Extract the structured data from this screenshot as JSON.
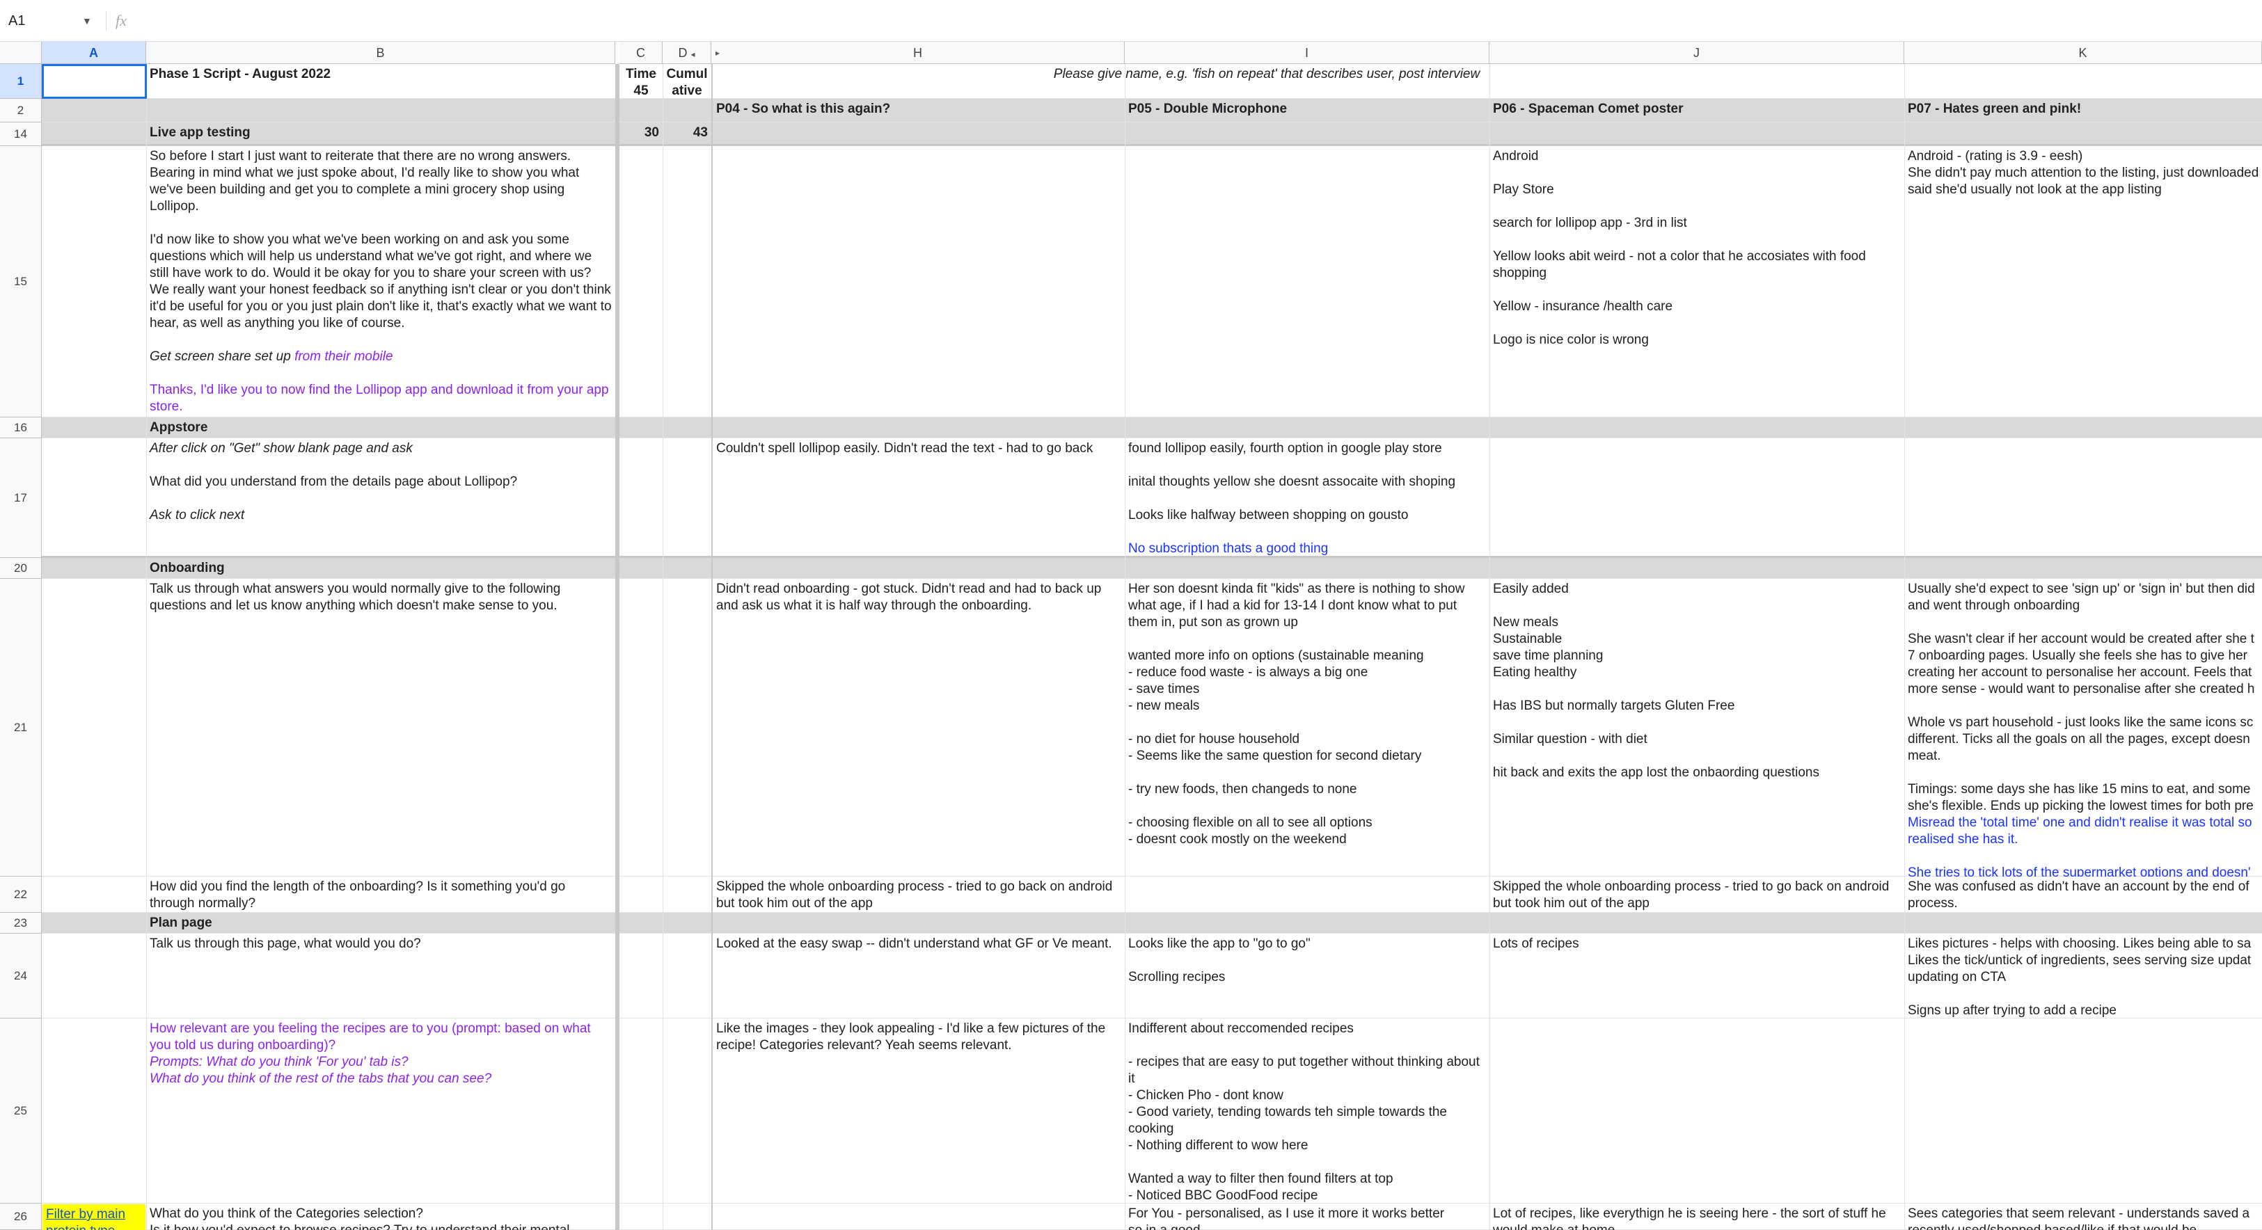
{
  "formula_bar": {
    "name_box": "A1",
    "fx": "fx",
    "value": ""
  },
  "columns": [
    "A",
    "B",
    "C",
    "D",
    "H",
    "I",
    "J",
    "K"
  ],
  "rows": {
    "r1": {
      "num": "1",
      "B": "Phase 1 Script - August 2022",
      "C": "Time\n45",
      "D": "Cumul\native",
      "H": "Please give name, e.g. 'fish on repeat' that describes user, post interview"
    },
    "r2": {
      "num": "2",
      "H": "P04 - So what is this again?",
      "I": "P05 - Double Microphone",
      "J": "P06 - Spaceman Comet poster",
      "K": "P07 - Hates green and pink!"
    },
    "r14": {
      "num": "14",
      "B": "Live app testing",
      "C": "30",
      "D": "43"
    },
    "r15": {
      "num": "15",
      "B1": "So before I start I just want to reiterate that there are no wrong answers. Bearing in mind what we just spoke about, I'd really like to show you what we've been building and get you to complete a mini grocery shop using Lollipop.\n\nI'd now like to show you what we've been working on and ask you some questions which will help us understand what we've got right, and where we still have work to do. Would it be okay for you to share your screen with us? We really want your honest feedback so if anything isn't clear or you don't think it'd be useful for you or you just plain don't like it, that's exactly what we want to hear, as well as anything you like of course.",
      "B2a": "Get screen share set up ",
      "B2b": "from their mobile",
      "B3": "Thanks, I'd like you to now find the Lollipop app and download it from your app store.",
      "J": "Android\n\nPlay Store\n\nsearch for lollipop app - 3rd in list\n\nYellow looks abit weird - not a color that he accosiates with food shopping\n\nYellow - insurance /health care\n\nLogo is nice color is wrong",
      "K": "Android - (rating is 3.9 - eesh)\nShe didn't pay much attention to the listing, just downloaded\nsaid she'd usually not look at the app listing"
    },
    "r16": {
      "num": "16",
      "B": "Appstore"
    },
    "r17": {
      "num": "17",
      "B1": "After click on \"Get\" show blank page and ask",
      "B2": "What did you understand from the details page about Lollipop?",
      "B3": "Ask to click next",
      "H": "Couldn't spell lollipop easily. Didn't read the text - had to go back",
      "I1": "found lollipop easily, fourth option in google play store\n\ninital thoughts yellow she doesnt assocaite with shoping\n\nLooks like halfway between shopping on gousto\n",
      "I2": "No subscription thats a good thing"
    },
    "r20": {
      "num": "20",
      "B": "Onboarding"
    },
    "r21": {
      "num": "21",
      "B": "Talk us through what answers you would normally give to the following questions and let us know anything which doesn't make sense to you.",
      "H": "Didn't read onboarding - got stuck. Didn't read and had to back up and ask us what it is half way through the onboarding.",
      "I": "Her son doesnt kinda fit \"kids\" as there is nothing to show what age, if I had a kid for 13-14 I dont know what to put them in, put son as grown up\n\nwanted more info on options (sustainable meaning\n- reduce food waste - is always a big one\n- save times\n- new meals\n\n- no diet for house household\n- Seems like the same question for second dietary\n\n- try new foods, then changeds to none\n\n- choosing flexible on all to see all options\n- doesnt cook mostly on the weekend",
      "J": "Easily added\n\nNew meals\nSustainable\nsave time planning\nEating healthy\n\nHas IBS but normally targets Gluten Free\n\nSimilar question - with diet\n\nhit back and exits the app lost the onbaording questions",
      "K1": "Usually she'd expect to see 'sign up' or 'sign in' but then did\nand went through onboarding\n\nShe wasn't clear if her account would be created after she t\n7 onboarding pages. Usually she feels she has to give her \ncreating her account to personalise her account. Feels that\nmore sense - would want to personalise after she created h\n\nWhole vs part household - just looks like the same icons sc\ndifferent. Ticks all the goals on all the pages, except doesn\nmeat.\n\nTimings: some days she has like 15 mins to eat, and some \nshe's flexible. Ends up picking the lowest times for both pre",
      "K2": "Misread the 'total time' one and didn't realise it was total so\nrealised she has it.\n\nShe tries to tick lots of the supermarket options and doesn'"
    },
    "r22": {
      "num": "22",
      "B": "How did you find the length of the onboarding? Is it something you'd go through normally?",
      "H": "Skipped the whole onboarding process - tried to go back on android but took him out of the app",
      "J": "Skipped the whole onboarding process - tried to go back on android but took him out of the app",
      "K": "She was confused as didn't have an account by the end of\nprocess."
    },
    "r23": {
      "num": "23",
      "B": "Plan page"
    },
    "r24": {
      "num": "24",
      "B": "Talk us through this page, what would you do?",
      "H": "Looked at the easy swap -- didn't understand what GF or Ve meant.",
      "I": "Looks like the app to \"go to go\"\n\nScrolling recipes",
      "J": "Lots of recipes",
      "K": "Likes pictures - helps with choosing. Likes being able to sa\nLikes the tick/untick of ingredients, sees serving size updat\nupdating on CTA\n\nSigns up after trying to add a recipe"
    },
    "r25": {
      "num": "25",
      "B1": "How relevant are you feeling the recipes are to you (prompt: based on what you told us during onboarding)?",
      "B2": "Prompts: What do you think 'For you' tab is?\nWhat do you think of the rest of the tabs that you can see?",
      "H": "Like the images - they look appealing - I'd like a few pictures of the recipe! Categories relevant? Yeah seems relevant.",
      "I": "Indifferent about reccomended recipes\n\n- recipes that are easy to put together without thinking about it\n- Chicken Pho - dont know\n- Good variety, tending towards teh simple towards the cooking\n- Nothing different to wow here\n\nWanted a way to filter then found filters at top\n- Noticed BBC GoodFood recipe"
    },
    "r26": {
      "num": "26",
      "A": "Filter by main protein type",
      "B": "What do you think of the Categories selection?\nIs it how you'd expect to browse recipes? Try to understand their mental",
      "I": "For You - personalised, as I use it more it works better\nso in a good",
      "J": "Lot of recipes, like everythign he is seeing here - the sort of stuff he\nwould make at home",
      "K": "Sees categories that seem relevant - understands saved a\nrecently used/shopped based/like if that would be"
    }
  }
}
